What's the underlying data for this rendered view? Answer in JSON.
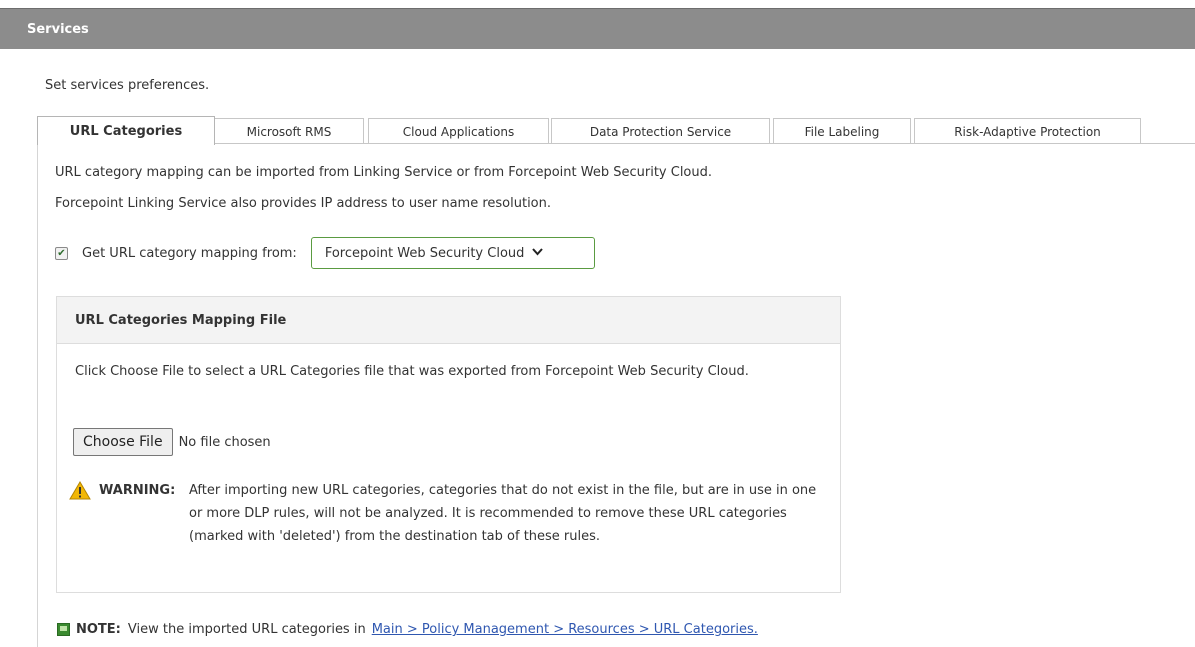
{
  "header": {
    "title": "Services"
  },
  "page": {
    "subtitle": "Set services preferences."
  },
  "tabs": [
    {
      "label": "URL Categories",
      "active": true
    },
    {
      "label": "Microsoft RMS",
      "active": false
    },
    {
      "label": "Cloud Applications",
      "active": false
    },
    {
      "label": "Data Protection Service",
      "active": false
    },
    {
      "label": "File Labeling",
      "active": false
    },
    {
      "label": "Risk-Adaptive Protection",
      "active": false
    }
  ],
  "url_categories": {
    "description_line1": "URL category mapping can be imported from Linking Service or from Forcepoint Web Security Cloud.",
    "description_line2": "Forcepoint Linking Service also provides IP address to user name resolution.",
    "checkbox_label": "Get URL category mapping from:",
    "checkbox_checked": true,
    "source_select_value": "Forcepoint Web Security Cloud",
    "panel": {
      "title": "URL Categories Mapping File",
      "instructions": "Click Choose File to select a URL Categories file that was exported from Forcepoint Web Security Cloud.",
      "choose_file_label": "Choose File",
      "no_file_text": "No file chosen",
      "warning_label": "WARNING:",
      "warning_text": "After importing new URL categories, categories that do not exist in the file, but are in use in one or more DLP rules, will not be analyzed. It is recommended to remove these URL categories (marked with 'deleted') from the destination tab of these rules."
    },
    "note": {
      "label": "NOTE:",
      "text": "View the imported URL categories in",
      "link": "Main > Policy Management > Resources > URL Categories."
    }
  },
  "colors": {
    "header_bar": "#8c8c8c",
    "select_border": "#5a9b41",
    "link": "#2f57b0",
    "warning_icon": "#f2b705",
    "note_icon": "#3a8a2f"
  }
}
